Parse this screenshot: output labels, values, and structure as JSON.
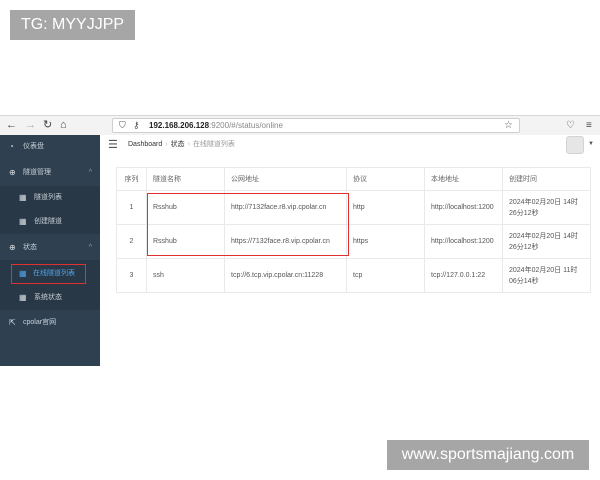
{
  "watermarks": {
    "top": "TG: MYYJJPP",
    "bottom": "www.sportsmajiang.com"
  },
  "browser": {
    "url_host": "192.168.206.128",
    "url_rest": ":9200/#/status/online"
  },
  "sidebar": {
    "items": [
      {
        "label": "仪表盘",
        "icon": "gauge-icon"
      },
      {
        "label": "隧道管理",
        "icon": "add-circle-icon",
        "expandable": true
      },
      {
        "label": "隧道列表",
        "icon": "grid-icon",
        "sub": true
      },
      {
        "label": "创建隧道",
        "icon": "grid-icon",
        "sub": true
      },
      {
        "label": "状态",
        "icon": "add-circle-icon",
        "expandable": true
      },
      {
        "label": "在线隧道列表",
        "icon": "grid-icon",
        "sub": true,
        "active": true
      },
      {
        "label": "系统状态",
        "icon": "grid-icon",
        "sub": true
      },
      {
        "label": "cpolar官网",
        "icon": "external-link-icon"
      }
    ]
  },
  "header": {
    "breadcrumb": [
      "Dashboard",
      "状态",
      "在线隧道列表"
    ]
  },
  "table": {
    "columns": [
      "序列",
      "隧道名称",
      "公网地址",
      "协议",
      "本地地址",
      "创建时间"
    ],
    "rows": [
      {
        "num": "1",
        "name": "Rsshub",
        "public": "http://7132face.r8.vip.cpolar.cn",
        "protocol": "http",
        "local": "http://localhost:1200",
        "time1": "2024年02月20日 14时",
        "time2": "26分12秒"
      },
      {
        "num": "2",
        "name": "Rsshub",
        "public": "https://7132face.r8.vip.cpolar.cn",
        "protocol": "https",
        "local": "http://localhost:1200",
        "time1": "2024年02月20日 14时",
        "time2": "26分12秒"
      },
      {
        "num": "3",
        "name": "ssh",
        "public": "tcp://6.tcp.vip.cpolar.cn:11228",
        "protocol": "tcp",
        "local": "tcp://127.0.0.1:22",
        "time1": "2024年02月20日 11时",
        "time2": "06分14秒"
      }
    ]
  },
  "colors": {
    "sidebar_bg": "#2f4050",
    "active_link": "#4fa3e8",
    "highlight_border": "#e03030"
  }
}
